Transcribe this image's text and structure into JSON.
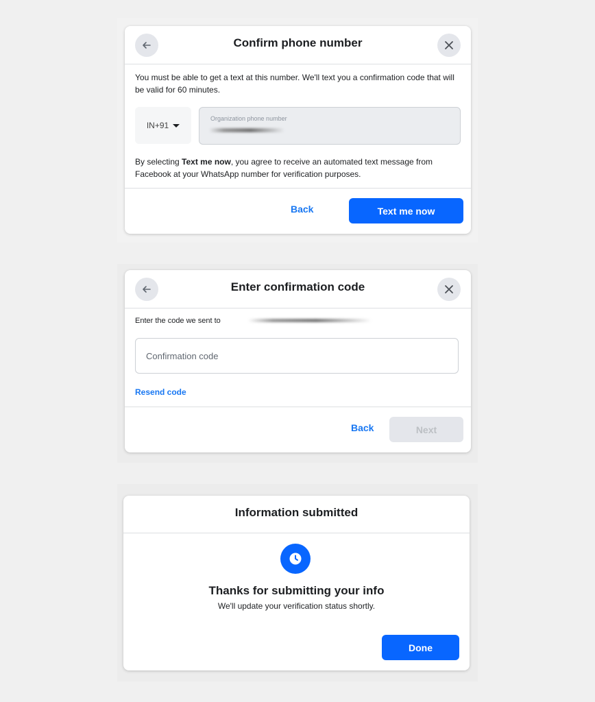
{
  "dialog1": {
    "title": "Confirm phone number",
    "description": "You must be able to get a text at this number. We'll text you a confirmation code that will be valid for 60 minutes.",
    "country_code": "IN+91",
    "phone_field_label": "Organization phone number",
    "consent_prefix": "By selecting ",
    "consent_bold": "Text me now",
    "consent_suffix": ", you agree to receive an automated text message from Facebook at your WhatsApp number for verification purposes.",
    "back_label": "Back",
    "primary_label": "Text me now"
  },
  "dialog2": {
    "title": "Enter confirmation code",
    "sent_to_text": "Enter the code we sent to",
    "code_placeholder": "Confirmation code",
    "resend_label": "Resend code",
    "back_label": "Back",
    "next_label": "Next"
  },
  "dialog3": {
    "title": "Information submitted",
    "thanks_text": "Thanks for submitting your info",
    "status_text": "We'll update your verification status shortly.",
    "done_label": "Done"
  },
  "colors": {
    "primary": "#0866ff",
    "link": "#1877f2",
    "background": "#f0f0f0"
  },
  "icons": [
    "arrow-left-icon",
    "close-icon",
    "caret-down-icon",
    "clock-icon"
  ]
}
